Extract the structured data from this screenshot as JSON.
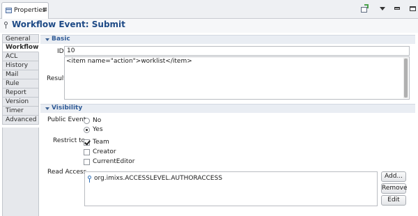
{
  "view": {
    "tab_label": "Properties",
    "tab_close": "⊠"
  },
  "title": "Workflow Event: Submit",
  "side_tabs": [
    "General",
    "Workflow",
    "ACL",
    "History",
    "Mail",
    "Rule",
    "Report",
    "Version",
    "Timer",
    "Advanced"
  ],
  "active_side_tab": "Workflow",
  "basic": {
    "section_label": "Basic",
    "id_label": "ID",
    "id_value": "10",
    "result_label": "Result",
    "result_value": "<item name=\"action\">worklist</item>"
  },
  "visibility": {
    "section_label": "Visibility",
    "public_event_label": "Public Event",
    "public_options": [
      {
        "label": "No",
        "selected": false
      },
      {
        "label": "Yes",
        "selected": true
      }
    ],
    "restrict_label": "Restrict to",
    "restrict_options": [
      {
        "label": "Team",
        "checked": true
      },
      {
        "label": "Creator",
        "checked": false
      },
      {
        "label": "CurrentEditor",
        "checked": false
      }
    ],
    "read_access_label": "Read Access",
    "read_access_items": [
      "org.imixs.ACCESSLEVEL.AUTHORACCESS"
    ],
    "buttons": {
      "add": "Add...",
      "remove": "Remove",
      "edit": "Edit"
    }
  },
  "colors": {
    "title": "#1e4a86",
    "section_label": "#2f5a96",
    "section_bg": "#e9edf3"
  },
  "icons": {
    "view_tab": "properties-view-icon",
    "title": "event-key-icon",
    "read_access_item": "key-icon"
  }
}
